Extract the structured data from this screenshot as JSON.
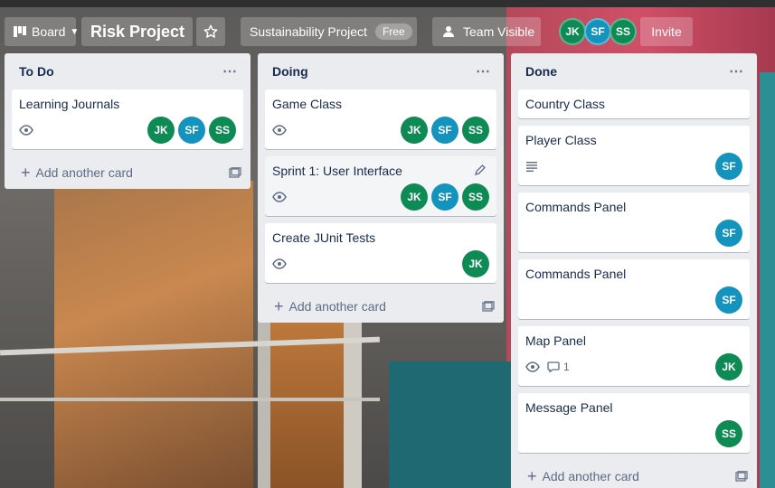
{
  "header": {
    "view_label": "Board",
    "board_title": "Risk Project",
    "workspace_name": "Sustainability Project",
    "plan_badge": "Free",
    "visibility_label": "Team Visible",
    "members": [
      "JK",
      "SF",
      "SS"
    ],
    "invite_label": "Invite"
  },
  "lists": [
    {
      "title": "To Do",
      "cards": [
        {
          "title": "Learning Journals",
          "watch": true,
          "members": [
            "JK",
            "SF",
            "SS"
          ]
        }
      ],
      "add_label": "Add another card"
    },
    {
      "title": "Doing",
      "cards": [
        {
          "title": "Game Class",
          "watch": true,
          "members": [
            "JK",
            "SF",
            "SS"
          ]
        },
        {
          "title": "Sprint 1: User Interface",
          "watch": true,
          "members": [
            "JK",
            "SF",
            "SS"
          ]
        },
        {
          "title": "Create JUnit Tests",
          "watch": true,
          "members": [
            "JK"
          ]
        }
      ],
      "add_label": "Add another card"
    },
    {
      "title": "Done",
      "cards": [
        {
          "title": "Country Class"
        },
        {
          "title": "Player Class",
          "description": true,
          "members": [
            "SF"
          ]
        },
        {
          "title": "Commands Panel",
          "members": [
            "SF"
          ]
        },
        {
          "title": "Commands Panel",
          "members": [
            "SF"
          ]
        },
        {
          "title": "Map Panel",
          "watch": true,
          "comments": "1",
          "members": [
            "JK"
          ]
        },
        {
          "title": "Message Panel",
          "members": [
            "SS"
          ]
        }
      ],
      "add_label": "Add another card"
    }
  ],
  "colors": {
    "member_green": "#0e8a55",
    "member_blue": "#1493bf",
    "list_bg": "#ebecf0",
    "text": "#172b4d"
  }
}
